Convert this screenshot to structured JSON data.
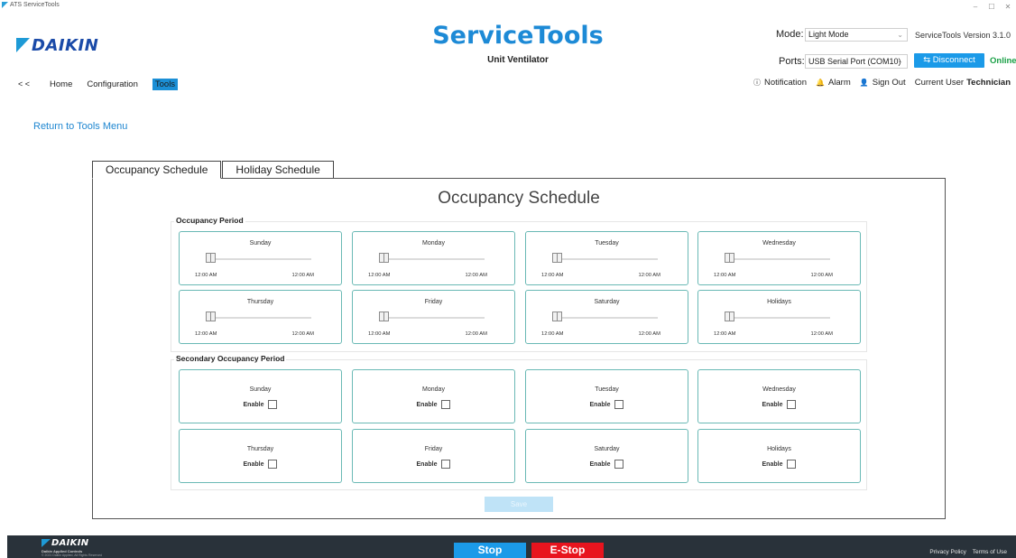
{
  "window": {
    "title": "ATS ServiceTools",
    "controls": {
      "minimize": "–",
      "maximize": "☐",
      "close": "✕"
    }
  },
  "brand": {
    "logo_text": "DAIKIN",
    "accent": "#1d8ad6"
  },
  "header": {
    "app_title": "ServiceTools",
    "subtitle": "Unit Ventilator",
    "mode_label": "Mode:",
    "mode_value": "Light Mode",
    "version": "ServiceTools Version  3.1.0",
    "ports_label": "Ports:",
    "port_value": "USB Serial Port (COM10)",
    "disconnect_label": "⇆ Disconnect",
    "status": "Online",
    "status_color": "#19a046"
  },
  "nav": {
    "back": "< <",
    "items": [
      "Home",
      "Configuration",
      "Tools"
    ],
    "active": "Tools"
  },
  "topright": {
    "notification": "Notification",
    "alarm": "Alarm",
    "sign_out": "Sign Out",
    "current_user_label": "Current User",
    "current_user": "Technician"
  },
  "return_link": "Return to Tools Menu",
  "tabs": [
    "Occupancy Schedule",
    "Holiday Schedule"
  ],
  "panel_title": "Occupancy Schedule",
  "occupancy_period": {
    "label": "Occupancy Period",
    "cards": [
      {
        "day": "Sunday",
        "start": "12:00 AM",
        "end": "12:00 AM"
      },
      {
        "day": "Monday",
        "start": "12:00 AM",
        "end": "12:00 AM"
      },
      {
        "day": "Tuesday",
        "start": "12:00 AM",
        "end": "12:00 AM"
      },
      {
        "day": "Wednesday",
        "start": "12:00 AM",
        "end": "12:00 AM"
      },
      {
        "day": "Thursday",
        "start": "12:00 AM",
        "end": "12:00 AM"
      },
      {
        "day": "Friday",
        "start": "12:00 AM",
        "end": "12:00 AM"
      },
      {
        "day": "Saturday",
        "start": "12:00 AM",
        "end": "12:00 AM"
      },
      {
        "day": "Holidays",
        "start": "12:00 AM",
        "end": "12:00 AM"
      }
    ]
  },
  "secondary_period": {
    "label": "Secondary Occupancy Period",
    "enable_label": "Enable",
    "cards": [
      {
        "day": "Sunday"
      },
      {
        "day": "Monday"
      },
      {
        "day": "Tuesday"
      },
      {
        "day": "Wednesday"
      },
      {
        "day": "Thursday"
      },
      {
        "day": "Friday"
      },
      {
        "day": "Saturday"
      },
      {
        "day": "Holidays"
      }
    ]
  },
  "save_label": "Save",
  "footer": {
    "logo_text": "DAIKIN",
    "company": "Daikin Applied Controls",
    "copyright": "© 2021 Daikin Applied, All Rights Reserved",
    "stop_label": "Stop",
    "estop_label": "E-Stop",
    "privacy": "Privacy Policy",
    "terms": "Terms of Use"
  }
}
